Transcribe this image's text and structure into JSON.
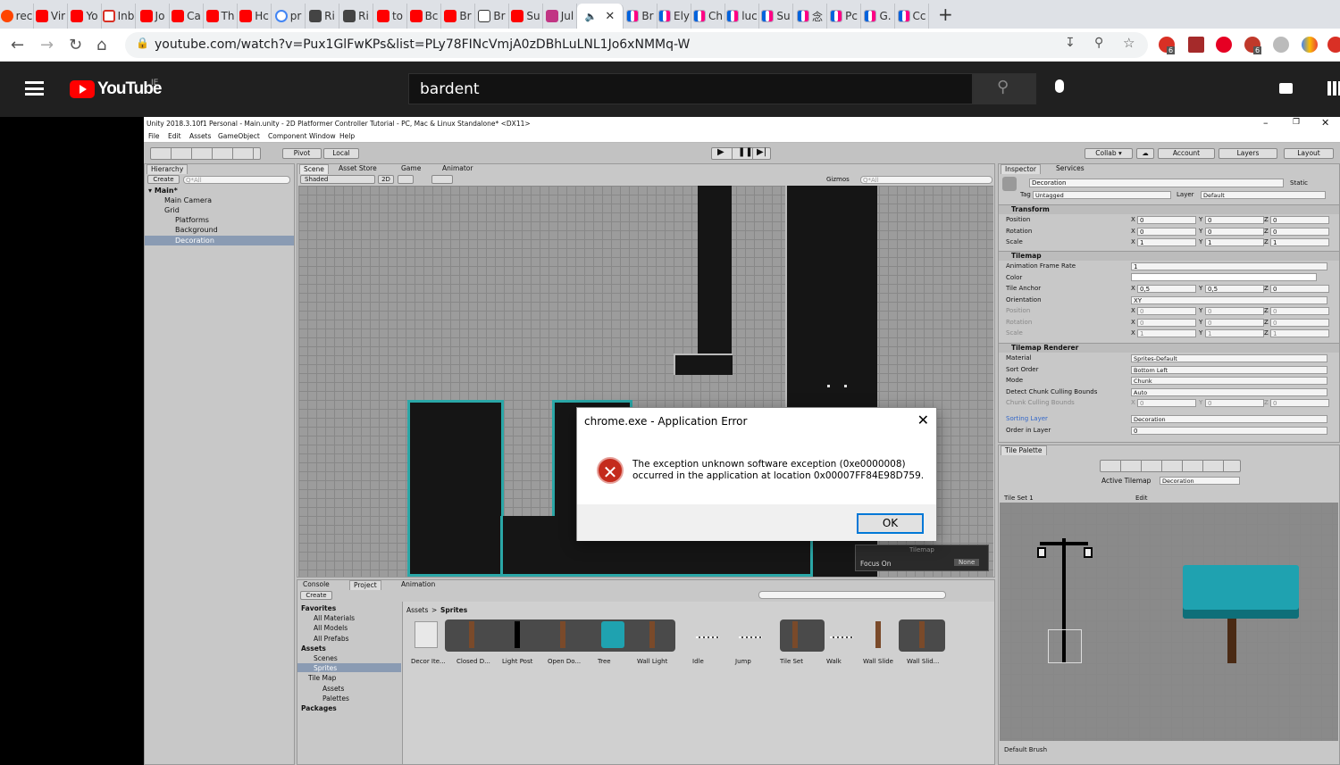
{
  "browser": {
    "tabs": [
      {
        "icon": "reddit-icon",
        "label": "rec"
      },
      {
        "icon": "youtube-icon",
        "label": "Vir"
      },
      {
        "icon": "youtube-icon",
        "label": "Yo"
      },
      {
        "icon": "gmail-icon",
        "label": "Inb"
      },
      {
        "icon": "youtube-icon",
        "label": "Jo"
      },
      {
        "icon": "youtube-icon",
        "label": "Ca"
      },
      {
        "icon": "youtube-icon",
        "label": "Th"
      },
      {
        "icon": "youtube-icon",
        "label": "Hc"
      },
      {
        "icon": "google-icon",
        "label": "pr"
      },
      {
        "icon": "vs-icon",
        "label": "Ri"
      },
      {
        "icon": "vs-icon",
        "label": "Ri"
      },
      {
        "icon": "youtube-icon",
        "label": "to"
      },
      {
        "icon": "youtube-icon",
        "label": "Bc"
      },
      {
        "icon": "youtube-icon",
        "label": "Br"
      },
      {
        "icon": "wikipedia-icon",
        "label": "Br"
      },
      {
        "icon": "youtube-icon",
        "label": "Su"
      },
      {
        "icon": "instagram-icon",
        "label": "Jul"
      },
      {
        "icon": "flickr-icon",
        "label": "Br"
      },
      {
        "icon": "flickr-icon",
        "label": "Ely"
      },
      {
        "icon": "flickr-icon",
        "label": "Ch"
      },
      {
        "icon": "flickr-icon",
        "label": "luc"
      },
      {
        "icon": "flickr-icon",
        "label": "Su"
      },
      {
        "icon": "flickr-icon",
        "label": "念"
      },
      {
        "icon": "flickr-icon",
        "label": "Pc"
      },
      {
        "icon": "flickr-icon",
        "label": "G."
      },
      {
        "icon": "flickr-icon",
        "label": "Cc"
      }
    ],
    "active_tab_icon": "speaker-icon",
    "new_tab": "+",
    "url": "youtube.com/watch?v=Pux1GlFwKPs&list=PLy78FINcVmjA0zDBhLuLNL1Jo6xNMMq-W",
    "ext_badges": [
      "6",
      "6"
    ]
  },
  "youtube": {
    "logo": "YouTube",
    "region": "IE",
    "search_value": "bardent"
  },
  "unity": {
    "title": "Unity 2018.3.10f1 Personal - Main.unity - 2D Platformer Controller Tutorial - PC, Mac & Linux Standalone* <DX11>",
    "menu": [
      "File",
      "Edit",
      "Assets",
      "GameObject",
      "Component",
      "Window",
      "Help"
    ],
    "toolbar": {
      "pivot": "Pivot",
      "local": "Local",
      "collab": "Collab ▾",
      "account": "Account",
      "layers": "Layers",
      "layout": "Layout"
    },
    "hierarchy": {
      "tab": "Hierarchy",
      "create": "Create",
      "search_placeholder": "Q*All",
      "scene": "Main*",
      "items": [
        "Main Camera",
        "Grid",
        "Platforms",
        "Background",
        "Decoration"
      ]
    },
    "scene": {
      "tabs": [
        "Scene",
        "Asset Store",
        "Game",
        "Animator"
      ],
      "shading": "Shaded",
      "mode2d": "2D",
      "gizmos": "Gizmos",
      "search_placeholder": "Q*All",
      "overlay_title": "Tilemap",
      "focus_on": "Focus On",
      "focus_value": "None"
    },
    "inspector": {
      "tabs": [
        "Inspector",
        "Services"
      ],
      "object_name": "Decoration",
      "static": "Static",
      "tag_label": "Tag",
      "tag": "Untagged",
      "layer_label": "Layer",
      "layer": "Default",
      "transform": {
        "title": "Transform",
        "rows": [
          {
            "label": "Position",
            "x": "0",
            "y": "0",
            "z": "0"
          },
          {
            "label": "Rotation",
            "x": "0",
            "y": "0",
            "z": "0"
          },
          {
            "label": "Scale",
            "x": "1",
            "y": "1",
            "z": "1"
          }
        ]
      },
      "tilemap": {
        "title": "Tilemap",
        "frame_rate_label": "Animation Frame Rate",
        "frame_rate": "1",
        "color_label": "Color",
        "anchor_label": "Tile Anchor",
        "anchor": {
          "x": "0,5",
          "y": "0,5",
          "z": "0"
        },
        "orientation_label": "Orientation",
        "orientation": "XY",
        "rows": [
          {
            "label": "Position",
            "x": "0",
            "y": "0",
            "z": "0"
          },
          {
            "label": "Rotation",
            "x": "0",
            "y": "0",
            "z": "0"
          },
          {
            "label": "Scale",
            "x": "1",
            "y": "1",
            "z": "1"
          }
        ]
      },
      "renderer": {
        "title": "Tilemap Renderer",
        "rows": [
          {
            "label": "Material",
            "value": "Sprites-Default"
          },
          {
            "label": "Sort Order",
            "value": "Bottom Left"
          },
          {
            "label": "Mode",
            "value": "Chunk"
          },
          {
            "label": "Detect Chunk Culling Bounds",
            "value": "Auto"
          }
        ],
        "culling_label": "Chunk Culling Bounds",
        "culling": {
          "x": "0",
          "y": "0",
          "z": "0"
        },
        "sorting_label": "Sorting Layer",
        "sorting": "Decoration",
        "order_label": "Order in Layer",
        "order": "0"
      }
    },
    "palette": {
      "tab": "Tile Palette",
      "active_label": "Active Tilemap",
      "active_value": "Decoration",
      "set": "Tile Set 1",
      "edit": "Edit",
      "brush": "Default Brush"
    },
    "project": {
      "tabs": [
        "Console",
        "Project",
        "Animation"
      ],
      "create": "Create",
      "breadcrumb": [
        "Assets",
        "Sprites"
      ],
      "tree": [
        {
          "label": "Favorites",
          "bold": true
        },
        {
          "label": "All Materials"
        },
        {
          "label": "All Models"
        },
        {
          "label": "All Prefabs"
        },
        {
          "label": "Assets",
          "bold": true
        },
        {
          "label": "Scenes"
        },
        {
          "label": "Sprites"
        },
        {
          "label": "Tile Map"
        },
        {
          "label": "Assets"
        },
        {
          "label": "Palettes"
        },
        {
          "label": "Packages",
          "bold": true
        }
      ],
      "assets": [
        "Decor Ite...",
        "Closed D...",
        "Light Post",
        "Open Do...",
        "Tree",
        "Wall Light",
        "Idle",
        "Jump",
        "Tile Set",
        "Walk",
        "Wall Slide",
        "Wall Slid..."
      ]
    }
  },
  "dialog": {
    "title": "chrome.exe - Application Error",
    "close": "✕",
    "icon": "error-icon",
    "line1": "The exception unknown software exception (0xe0000008)",
    "line2": "occurred in the application at location 0x00007FF84E98D759.",
    "ok": "OK"
  }
}
